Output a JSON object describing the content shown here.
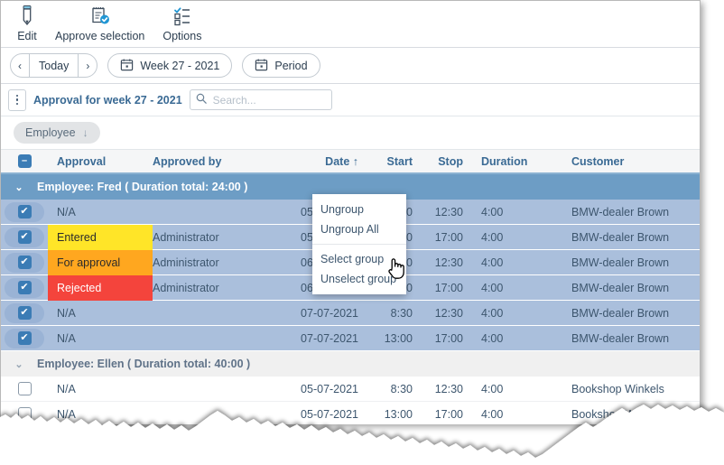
{
  "ribbon": {
    "buttons": [
      {
        "label": "Edit",
        "icon": "pencil-icon"
      },
      {
        "label": "Approve selection",
        "icon": "approve-list-icon"
      },
      {
        "label": "Options",
        "icon": "options-list-icon"
      }
    ]
  },
  "navbar": {
    "prev_label": "‹",
    "today_label": "Today",
    "next_label": "›",
    "week_label": "Week 27 - 2021",
    "period_label": "Period",
    "calendar_icon": "calendar-icon"
  },
  "titlebar": {
    "menu_icon": "kebab-menu-icon",
    "title": "Approval for week 27 - 2021",
    "search_icon": "search-icon",
    "search_placeholder": "Search...",
    "search_value": ""
  },
  "groupbar": {
    "chip_label": "Employee",
    "sort_arrow": "↓"
  },
  "table": {
    "select_all_state": "indeterminate",
    "columns": [
      {
        "key": "approval",
        "label": "Approval"
      },
      {
        "key": "approved_by",
        "label": "Approved by"
      },
      {
        "key": "date",
        "label": "Date ↑"
      },
      {
        "key": "start",
        "label": "Start"
      },
      {
        "key": "stop",
        "label": "Stop"
      },
      {
        "key": "duration",
        "label": "Duration"
      },
      {
        "key": "customer",
        "label": "Customer"
      }
    ],
    "groups": [
      {
        "header": "Employee: Fred ( Duration total: 24:00 )",
        "state": "active",
        "caret": "⌄",
        "rows": [
          {
            "checked": true,
            "approval": "N/A",
            "status": "none",
            "approved_by": "",
            "date": "05-07-2021",
            "start": "8:30",
            "stop": "12:30",
            "duration": "4:00",
            "customer": "BMW-dealer Brown"
          },
          {
            "checked": true,
            "approval": "Entered",
            "status": "entered",
            "approved_by": "Administrator",
            "date": "05-07-2021",
            "start": "13:00",
            "stop": "17:00",
            "duration": "4:00",
            "customer": "BMW-dealer Brown"
          },
          {
            "checked": true,
            "approval": "For approval",
            "status": "approval",
            "approved_by": "Administrator",
            "date": "06-07-2021",
            "start": "8:30",
            "stop": "12:30",
            "duration": "4:00",
            "customer": "BMW-dealer Brown"
          },
          {
            "checked": true,
            "approval": "Rejected",
            "status": "rejected",
            "approved_by": "Administrator",
            "date": "06-07-2021",
            "start": "13:00",
            "stop": "17:00",
            "duration": "4:00",
            "customer": "BMW-dealer Brown"
          },
          {
            "checked": true,
            "approval": "N/A",
            "status": "none",
            "approved_by": "",
            "date": "07-07-2021",
            "start": "8:30",
            "stop": "12:30",
            "duration": "4:00",
            "customer": "BMW-dealer Brown"
          },
          {
            "checked": true,
            "approval": "N/A",
            "status": "none",
            "approved_by": "",
            "date": "07-07-2021",
            "start": "13:00",
            "stop": "17:00",
            "duration": "4:00",
            "customer": "BMW-dealer Brown"
          }
        ]
      },
      {
        "header": "Employee: Ellen ( Duration total: 40:00 )",
        "state": "idle",
        "caret": "⌄",
        "rows": [
          {
            "checked": false,
            "approval": "N/A",
            "status": "none",
            "approved_by": "",
            "date": "05-07-2021",
            "start": "8:30",
            "stop": "12:30",
            "duration": "4:00",
            "customer": "Bookshop Winkels"
          },
          {
            "checked": false,
            "approval": "N/A",
            "status": "none",
            "approved_by": "",
            "date": "05-07-2021",
            "start": "13:00",
            "stop": "17:00",
            "duration": "4:00",
            "customer": "Bookshop Winkels"
          }
        ]
      }
    ]
  },
  "context_menu": {
    "items": [
      {
        "label": "Ungroup"
      },
      {
        "label": "Ungroup All"
      },
      {
        "separator": true
      },
      {
        "label": "Select group"
      },
      {
        "label": "Unselect group"
      }
    ],
    "item0": "Ungroup",
    "item1": "Ungroup All",
    "item2": "Select group",
    "item3": "Unselect group"
  },
  "colors": {
    "accent": "#3a6a94",
    "selected_row": "#aabfdc",
    "group_active": "#6d9dc5",
    "status_entered": "#ffe528",
    "status_for_approval": "#ffa71f",
    "status_rejected": "#f4443c"
  }
}
